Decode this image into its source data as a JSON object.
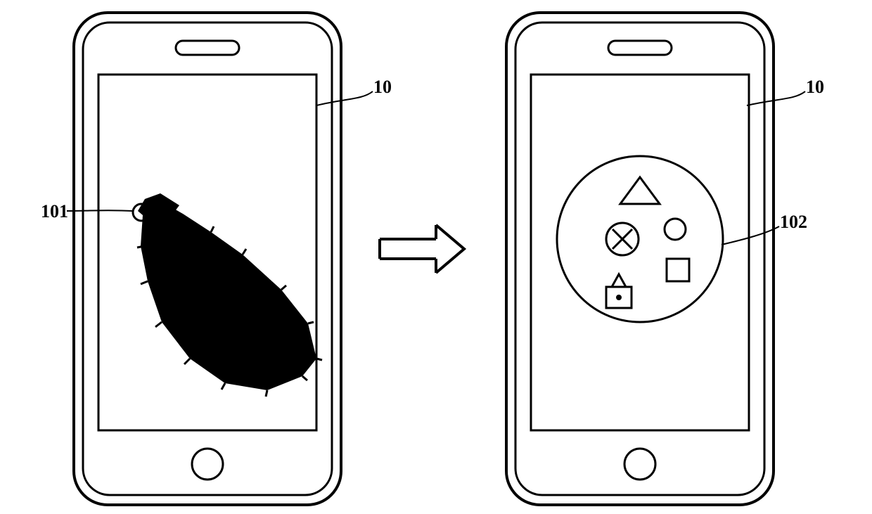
{
  "labels": {
    "screen_left": "10",
    "screen_right": "10",
    "touch_point": "101",
    "menu_circle": "102"
  }
}
